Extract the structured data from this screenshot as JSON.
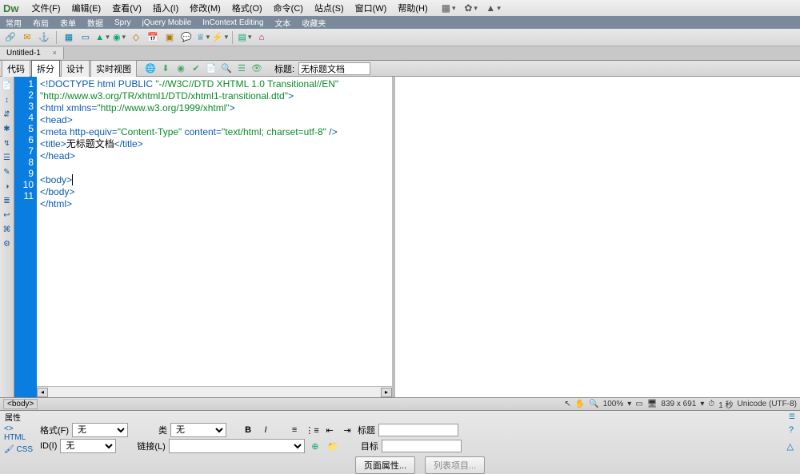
{
  "app": {
    "logo": "Dw"
  },
  "menu": {
    "file": "文件(F)",
    "edit": "编辑(E)",
    "view": "查看(V)",
    "insert": "插入(I)",
    "modify": "修改(M)",
    "format": "格式(O)",
    "commands": "命令(C)",
    "site": "站点(S)",
    "window": "窗口(W)",
    "help": "帮助(H)"
  },
  "categoryTabs": [
    "常用",
    "布局",
    "表单",
    "数据",
    "Spry",
    "jQuery Mobile",
    "InContext Editing",
    "文本",
    "收藏夹"
  ],
  "docTab": {
    "name": "Untitled-1",
    "close": "×"
  },
  "viewbar": {
    "code": "代码",
    "split": "拆分",
    "design": "设计",
    "live": "实时视图",
    "titleLabel": "标题:",
    "titleValue": "无标题文档"
  },
  "gutter": [
    "1",
    "2",
    "3",
    "4",
    "5",
    "6",
    "7",
    "8",
    "9",
    "10",
    "11"
  ],
  "code": {
    "l1a": "<!DOCTYPE html PUBLIC ",
    "l1b": "\"-//W3C//DTD XHTML 1.0 Transitional//EN\"",
    "l1c": "\"http://www.w3.org/TR/xhtml1/DTD/xhtml1-transitional.dtd\"",
    "l1d": ">",
    "l2a": "<html xmlns=",
    "l2b": "\"http://www.w3.org/1999/xhtml\"",
    "l2c": ">",
    "l3": "<head>",
    "l4a": "<meta http-equiv=",
    "l4b": "\"Content-Type\"",
    "l4c": " content=",
    "l4d": "\"text/html; charset=utf-8\"",
    "l4e": " />",
    "l5a": "<title>",
    "l5b": "无标题文档",
    "l5c": "</title>",
    "l6": "</head>",
    "l7": "",
    "l8": "<body>",
    "l9": "</body>",
    "l10": "</html>",
    "l11": ""
  },
  "pathbar": {
    "crumb": "<body>",
    "zoom": "100%",
    "dims": "839 x 691",
    "size": "1 秒",
    "enc": "Unicode (UTF-8)"
  },
  "props": {
    "title": "属性",
    "html": "HTML",
    "css": "CSS",
    "formatLabel": "格式(F)",
    "formatValue": "无",
    "classLabel": "类",
    "classValue": "无",
    "idLabel": "ID(I)",
    "idValue": "无",
    "linkLabel": "链接(L)",
    "linkValue": "",
    "titleLabel2": "标题",
    "targetLabel": "目标",
    "pageProps": "页面属性...",
    "listItem": "列表项目..."
  }
}
